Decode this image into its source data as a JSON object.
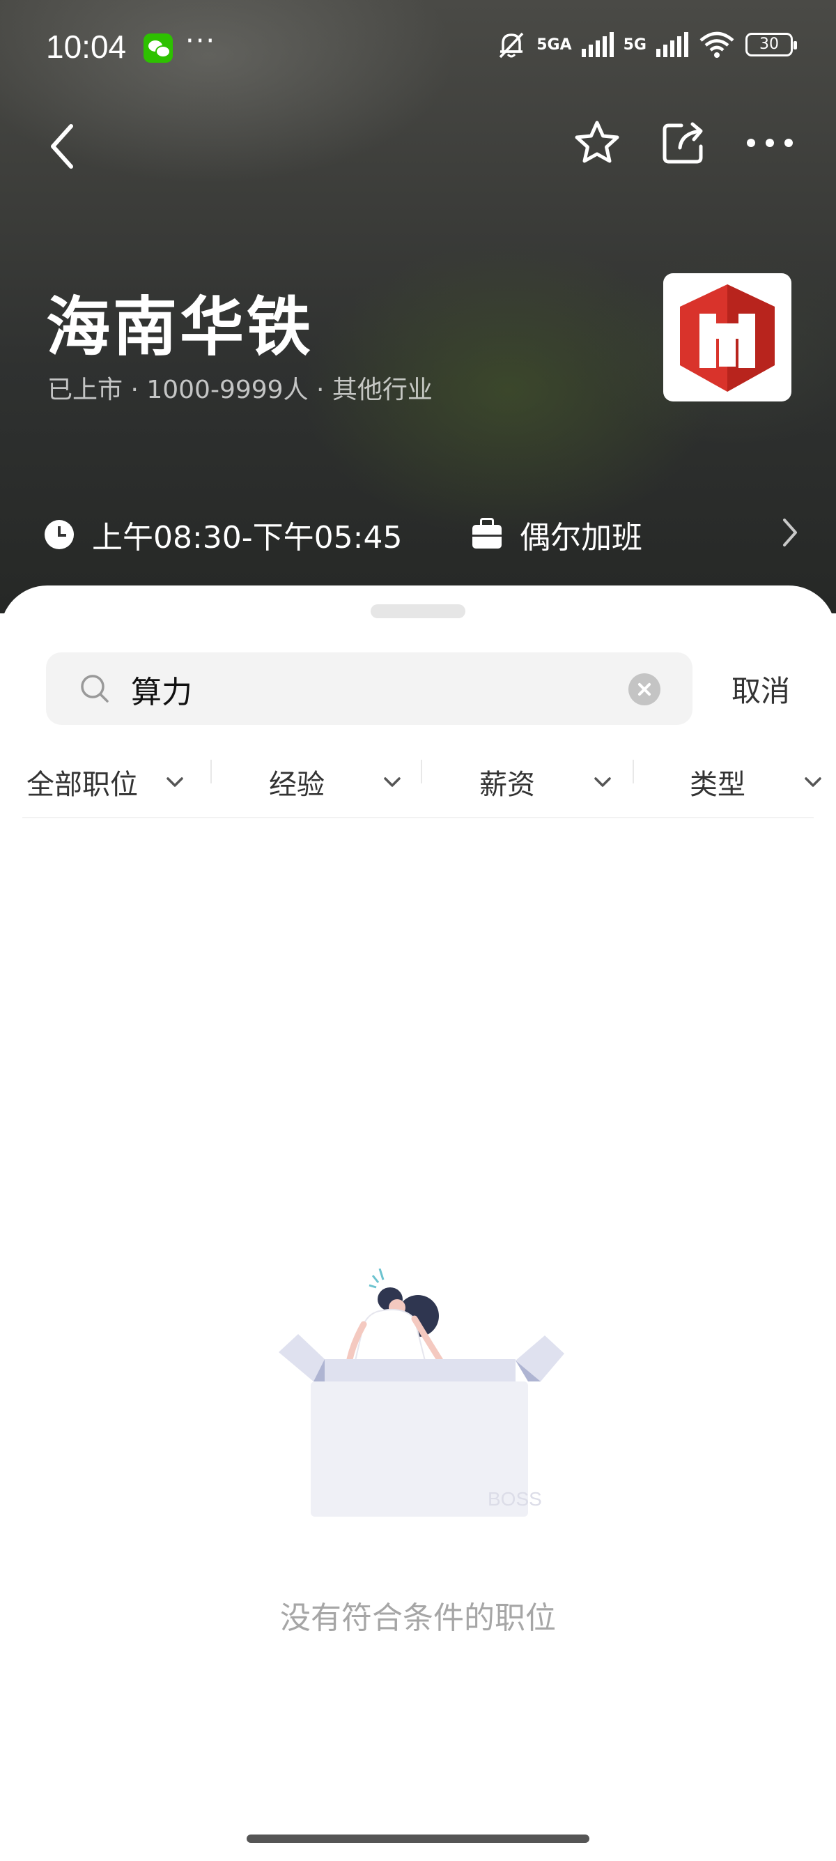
{
  "status_bar": {
    "time": "10:04",
    "dots": "···",
    "signal1": "5GA",
    "signal2": "5G",
    "battery": "30"
  },
  "header": {
    "company_name": "海南华铁",
    "company_meta": "已上市 · 1000-9999人 · 其他行业",
    "work_hours": "上午08:30-下午05:45",
    "overtime": "偶尔加班"
  },
  "search": {
    "query": "算力",
    "cancel_label": "取消"
  },
  "filters": [
    {
      "label": "全部职位"
    },
    {
      "label": "经验"
    },
    {
      "label": "薪资"
    },
    {
      "label": "类型"
    }
  ],
  "empty_state": {
    "message": "没有符合条件的职位",
    "box_brand": "BOSS"
  },
  "colors": {
    "logo_red": "#d9332b",
    "empty_text": "#a6a6a6"
  }
}
